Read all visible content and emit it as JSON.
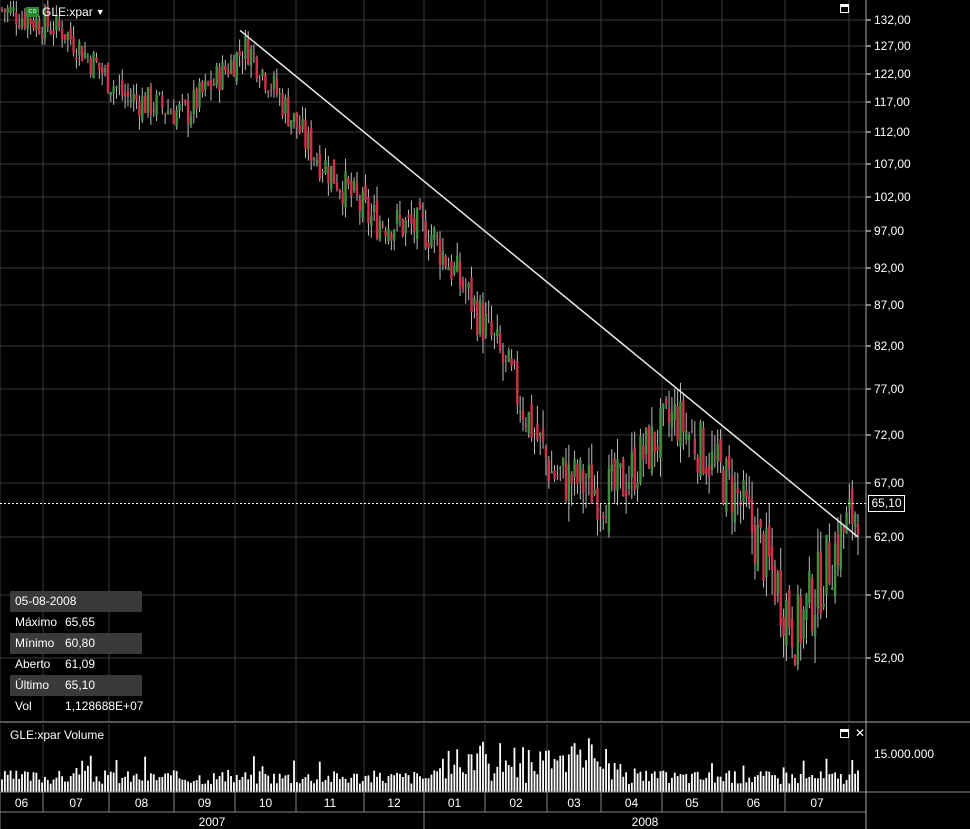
{
  "symbol": {
    "label": "GLE:xpar",
    "icon": "chart-icon"
  },
  "price_axis": [
    "132,00",
    "127,00",
    "122,00",
    "117,00",
    "112,00",
    "107,00",
    "102,00",
    "97,00",
    "92,00",
    "87,00",
    "82,00",
    "77,00",
    "72,00",
    "67,00",
    "62,00",
    "57,00",
    "52,00"
  ],
  "last_price": "65,10",
  "info": {
    "date": "05-08-2008",
    "max_label": "Máximo",
    "max_value": "65,65",
    "min_label": "Mínimo",
    "min_value": "60,80",
    "open_label": "Aberto",
    "open_value": "61,09",
    "last_label": "Último",
    "last_value": "65,10",
    "vol_label": "Vol",
    "vol_value": "1,128688E+07"
  },
  "volume_panel": {
    "title": "GLE:xpar Volume",
    "axis_label": "15.000.000"
  },
  "time_axis": {
    "months": [
      "06",
      "07",
      "08",
      "09",
      "10",
      "11",
      "12",
      "01",
      "02",
      "03",
      "04",
      "05",
      "06",
      "07"
    ],
    "years": [
      "2007",
      "2008"
    ]
  },
  "colors": {
    "up": "#3f8f3f",
    "down": "#d0304a",
    "volume": "#ffffff",
    "grid": "#3a3a3a",
    "trendline": "#e8e8e8"
  },
  "chart_data": {
    "type": "candlestick",
    "period": "2007-06 to 2008-08-05",
    "ylim": [
      48,
      134
    ],
    "x": [
      "2007-06",
      "2007-07",
      "2007-08",
      "2007-09",
      "2007-10",
      "2007-11",
      "2007-12",
      "2008-01",
      "2008-02",
      "2008-03",
      "2008-04",
      "2008-05",
      "2008-06",
      "2008-07",
      "2008-08"
    ],
    "close": [
      134,
      130,
      118,
      115,
      127,
      110,
      99,
      97,
      83,
      68,
      66,
      74,
      66,
      54,
      65.1
    ],
    "trendline": [
      [
        "2007-10",
        130
      ],
      [
        "2008-08",
        62
      ]
    ],
    "last": {
      "date": "05-08-2008",
      "open": 61.09,
      "high": 65.65,
      "low": 60.8,
      "close": 65.1,
      "volume": 11286880
    }
  }
}
